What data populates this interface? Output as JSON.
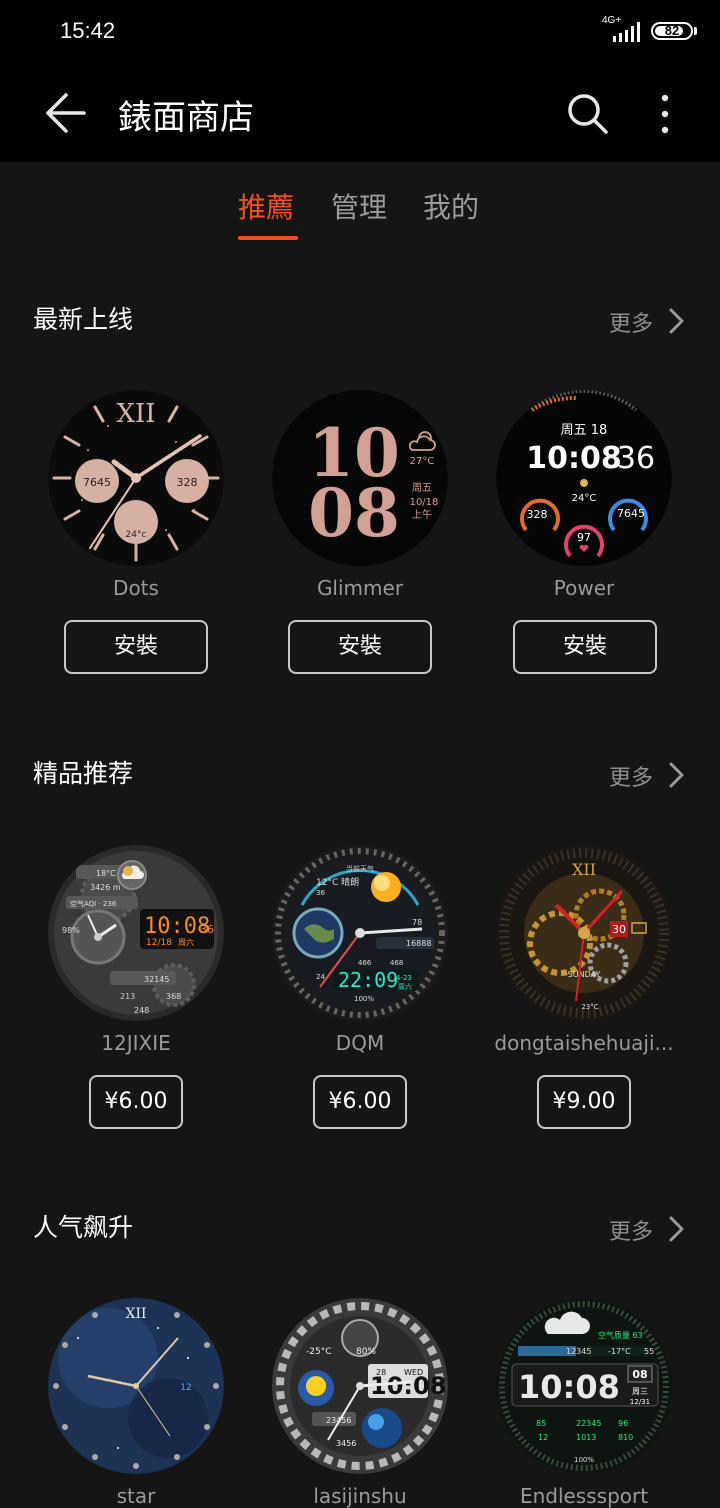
{
  "status_bar": {
    "time": "15:42",
    "network": "4G+",
    "battery": "82",
    "battery_level": 0.82
  },
  "app_bar": {
    "title": "錶面商店",
    "icons": [
      "back-arrow-icon",
      "search-icon",
      "more-vertical-icon"
    ]
  },
  "tabs": [
    {
      "label": "推薦",
      "active": true
    },
    {
      "label": "管理",
      "active": false
    },
    {
      "label": "我的",
      "active": false
    }
  ],
  "sections": [
    {
      "title": "最新上线",
      "more_label": "更多",
      "items": [
        {
          "name": "Dots",
          "action": "安裝",
          "face": {
            "numeral": "XII",
            "steps": "7645",
            "heart": "328",
            "temp": "24°c"
          }
        },
        {
          "name": "Glimmer",
          "action": "安裝",
          "face": {
            "hour": "10",
            "minute": "08",
            "temp": "27°C",
            "weekday": "周五",
            "date": "10/18",
            "ampm": "上午"
          }
        },
        {
          "name": "Power",
          "action": "安裝",
          "face": {
            "date": "周五 18",
            "time": "10:08",
            "seconds": "36",
            "temp": "24°C",
            "left": "328",
            "right": "7645",
            "bottom": "97"
          }
        }
      ]
    },
    {
      "title": "精品推荐",
      "more_label": "更多",
      "items": [
        {
          "name": "12JIXIE",
          "action": "¥6.00",
          "face": {
            "temp": "18°C",
            "alt": "3426 m",
            "aqi": "空气AQI · 236",
            "time": "10:08",
            "seconds": "36",
            "date": "12/18",
            "weekday": "周六",
            "pct": "98%",
            "steps": "32145",
            "v1": "213",
            "v2": "368",
            "v3": "248"
          }
        },
        {
          "name": "DQM",
          "action": "¥6.00",
          "face": {
            "weather": "12°C  晴朗",
            "humidity": "36",
            "header": "当前天气",
            "heart": "78",
            "steps": "16888",
            "v1": "466",
            "v2": "468",
            "time": "22:09",
            "date": "4-23",
            "weekday": "周六",
            "battery": "100%",
            "day": "24"
          }
        },
        {
          "name": "dongtaishehuaji...",
          "action": "¥9.00",
          "face": {
            "numeral": "XII",
            "date": "30",
            "weekday": "SUNDAY",
            "temp": "23°C"
          }
        }
      ]
    },
    {
      "title": "人气飙升",
      "more_label": "更多",
      "items": [
        {
          "name": "star",
          "face": {
            "numeral": "XII",
            "date": "12"
          }
        },
        {
          "name": "lasijinshu",
          "face": {
            "temp": "-25°C",
            "pct": "80%",
            "time": "10:08",
            "day": "28",
            "weekday": "WED",
            "steps": "23456",
            "v2": "3456"
          }
        },
        {
          "name": "Endlesssport",
          "face": {
            "aqi": "空气质量 63",
            "steps": "12345",
            "temp": "-17°C",
            "v": "55",
            "time": "10:08",
            "date": "08",
            "weekday": "周三",
            "date2": "12/31",
            "a": "85",
            "b": "22345",
            "c": "96",
            "d": "12",
            "e": "1013",
            "f": "810",
            "battery": "100%"
          }
        }
      ]
    }
  ]
}
